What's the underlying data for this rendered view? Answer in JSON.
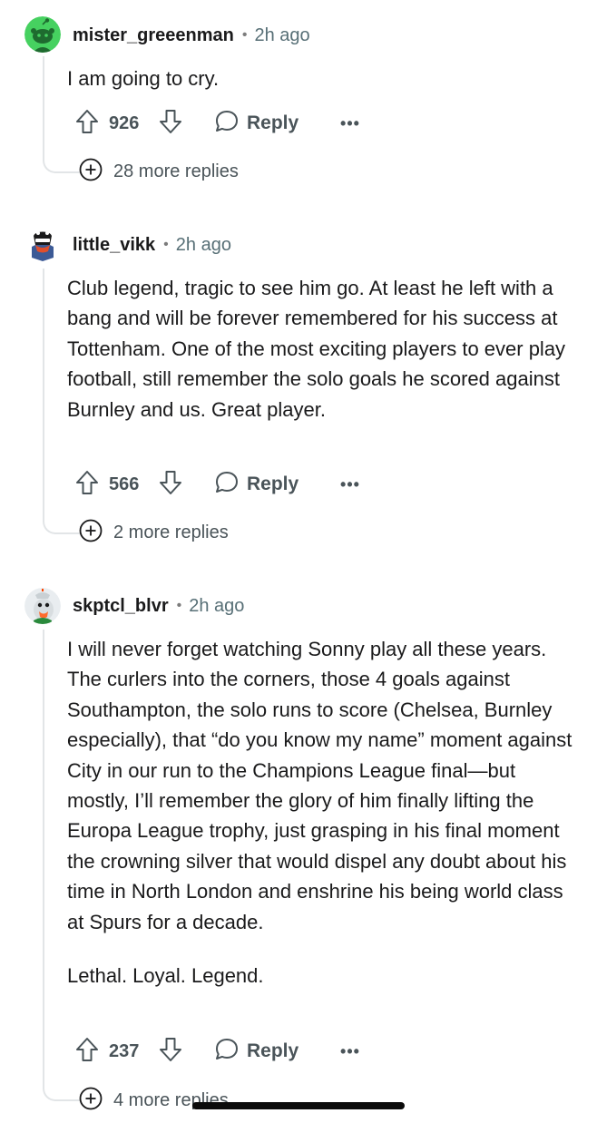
{
  "comments": [
    {
      "username": "mister_greeenman",
      "separator": "•",
      "time": "2h ago",
      "body": [
        "I am going to cry."
      ],
      "score": "926",
      "reply_label": "Reply",
      "more_label": "•••",
      "more_replies": "28 more replies"
    },
    {
      "username": "little_vikk",
      "separator": "•",
      "time": "2h ago",
      "body": [
        "Club legend, tragic to see him go. At least he left with a bang and will be forever remembered for his success at Tottenham. One of the most exciting players to ever play football, still remember the solo goals he scored against Burnley and us. Great player."
      ],
      "score": "566",
      "reply_label": "Reply",
      "more_label": "•••",
      "more_replies": "2 more replies"
    },
    {
      "username": "skptcl_blvr",
      "separator": "•",
      "time": "2h ago",
      "body": [
        "I will never forget watching Sonny play all these years. The curlers into the corners, those 4 goals against Southampton, the solo runs to score (Chelsea, Burnley especially), that “do you know my name” moment against City in our run to the Champions League final—but mostly, I’ll remember the glory of him finally lifting the Europa League trophy, just grasping in his final moment the crowning silver that would dispel any doubt about his time in North London and enshrine his being world class at Spurs for a decade.",
        "Lethal. Loyal. Legend."
      ],
      "score": "237",
      "reply_label": "Reply",
      "more_label": "•••",
      "more_replies": "4 more replies"
    }
  ],
  "colors": {
    "text": "#1a1a1b",
    "muted": "#576f76",
    "action": "#4a5459",
    "thread_line": "#e2e5e7",
    "avatar_green": "#46d160"
  },
  "icons": {
    "upvote": "arrow-up-outline-icon",
    "downvote": "arrow-down-outline-icon",
    "reply": "speech-bubble-icon",
    "more": "ellipsis-icon",
    "expand": "plus-circle-icon"
  }
}
